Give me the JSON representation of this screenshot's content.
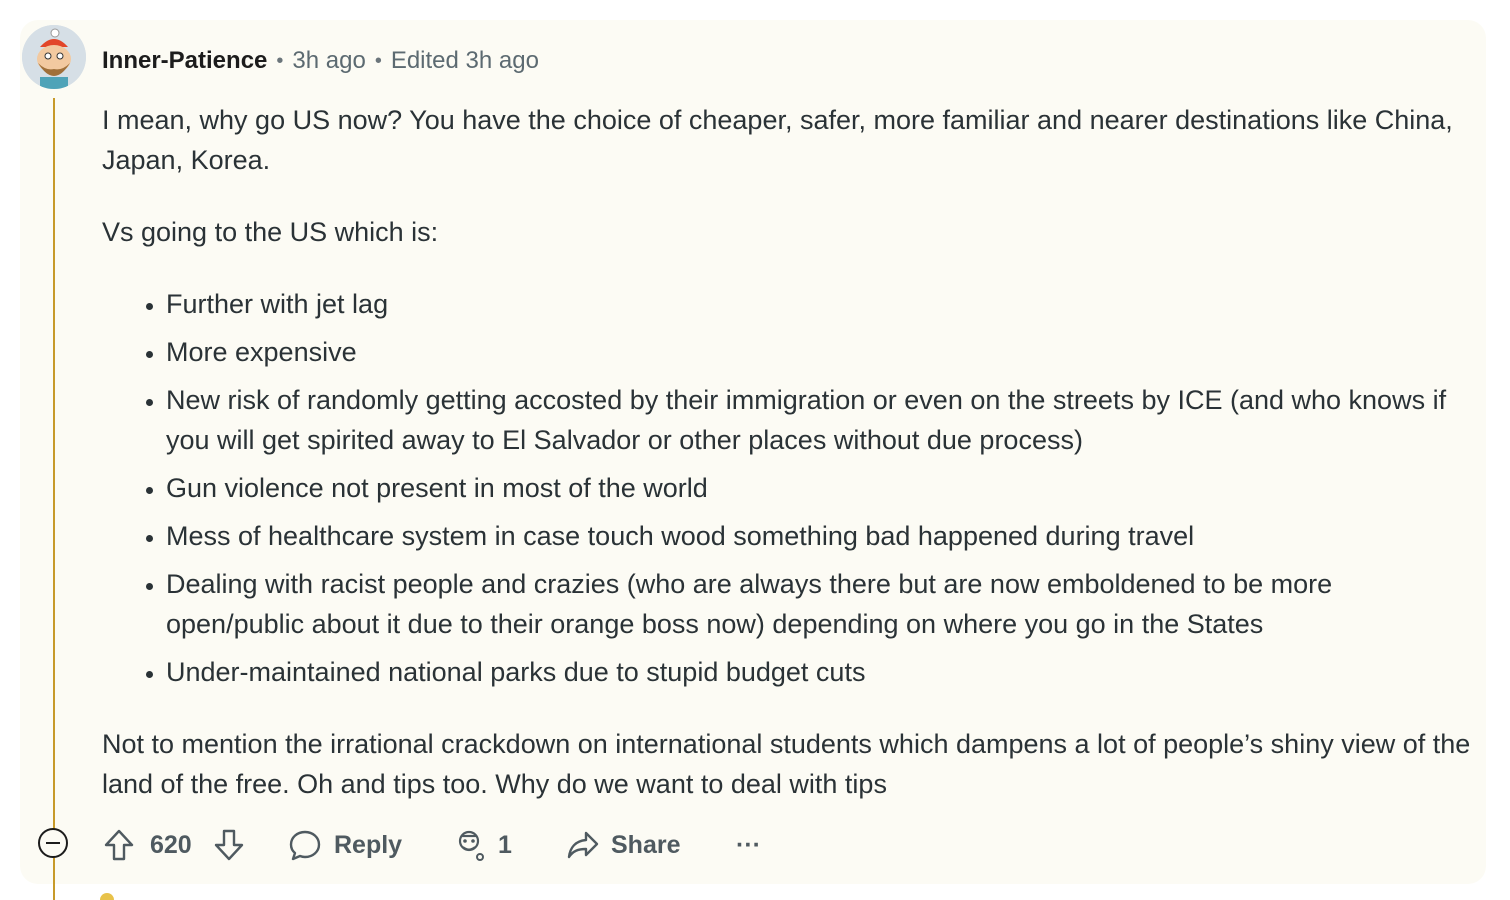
{
  "comment": {
    "username": "Inner-Patience",
    "posted": "3h ago",
    "edited": "Edited 3h ago",
    "paragraph_1": "I mean, why go US now? You have the choice of cheaper, safer, more familiar and nearer destinations like China, Japan, Korea.",
    "paragraph_2": "Vs going to the US which is:",
    "bullets": [
      "Further with jet lag",
      "More expensive",
      "New risk of randomly getting accosted by their immigration or even on the streets by ICE (and who knows if you will get spirited away to El Salvador or other places without due process)",
      "Gun violence not present in most of the world",
      "Mess of healthcare system in case touch wood something bad happened during travel",
      "Dealing with racist people and crazies (who are always there but are now emboldened to be more open/public about it due to their orange boss now) depending on where you go in the States",
      "Under-maintained national parks due to stupid budget cuts"
    ],
    "paragraph_3": "Not to mention the irrational crackdown on international students which dampens a lot of people’s shiny view of the land of the free. Oh and tips too. Why do we want to deal with tips"
  },
  "actions": {
    "vote_count": "620",
    "reply_label": "Reply",
    "award_count": "1",
    "share_label": "Share",
    "more_label": "···"
  },
  "colors": {
    "card_background": "#fcfbf4",
    "thread_line": "#c79a2a",
    "text": "#2a3236",
    "meta": "#5c6a71"
  },
  "icons": {
    "upvote": "arrow-up-icon",
    "downvote": "arrow-down-icon",
    "reply": "speech-bubble-icon",
    "award": "award-icon",
    "share": "share-arrow-icon",
    "more": "ellipsis-icon",
    "collapse": "minus-circle-icon"
  }
}
